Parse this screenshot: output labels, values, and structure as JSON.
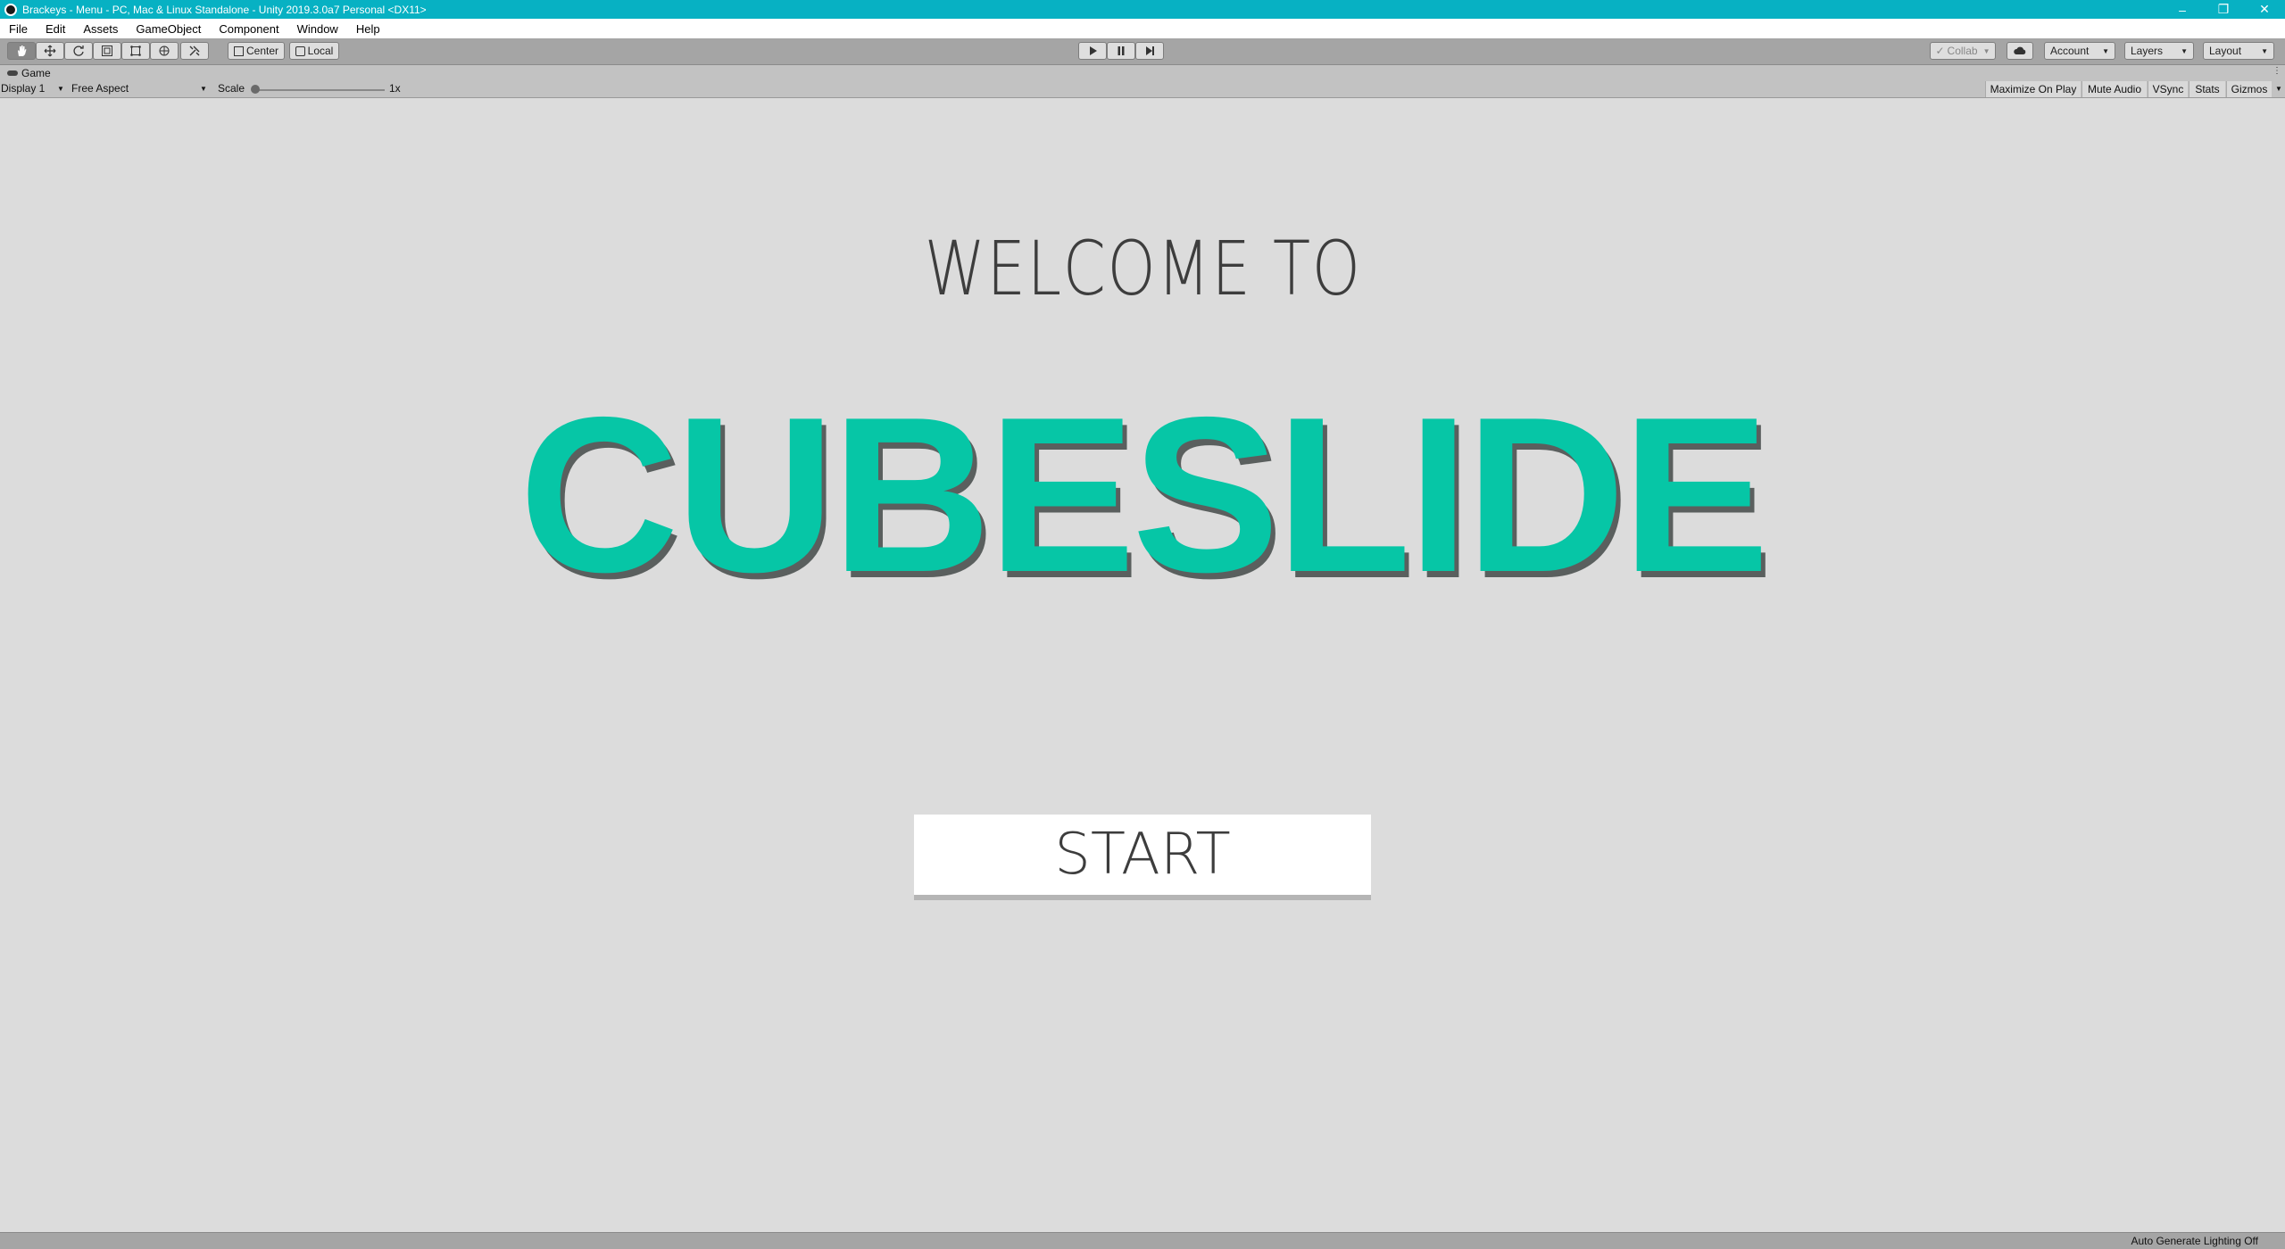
{
  "window": {
    "title": "Brackeys - Menu - PC, Mac & Linux Standalone - Unity 2019.3.0a7 Personal <DX11>",
    "minimize": "–",
    "restore": "❐",
    "close": "✕"
  },
  "menu": [
    "File",
    "Edit",
    "Assets",
    "GameObject",
    "Component",
    "Window",
    "Help"
  ],
  "toolbar": {
    "center_label": "Center",
    "local_label": "Local",
    "collab_label": "Collab",
    "account_label": "Account",
    "layers_label": "Layers",
    "layout_label": "Layout"
  },
  "game_view": {
    "tab_label": "Game",
    "display_label": "Display 1",
    "aspect_label": "Free Aspect",
    "scale_label": "Scale",
    "scale_value": "1x",
    "scale_fraction": 0.0,
    "maximize_label": "Maximize On Play",
    "mute_label": "Mute Audio",
    "vsync_label": "VSync",
    "stats_label": "Stats",
    "gizmos_label": "Gizmos"
  },
  "scene": {
    "welcome_text": "WELCOME TO",
    "game_title": "CUBESLIDE",
    "start_label": "START",
    "title_color": "#06c6a6"
  },
  "status": {
    "lighting_text": "Auto Generate Lighting Off"
  },
  "colors": {
    "titlebar": "#07b1c3",
    "toolbar": "#a5a5a5",
    "viewport": "#dcdcdc"
  }
}
